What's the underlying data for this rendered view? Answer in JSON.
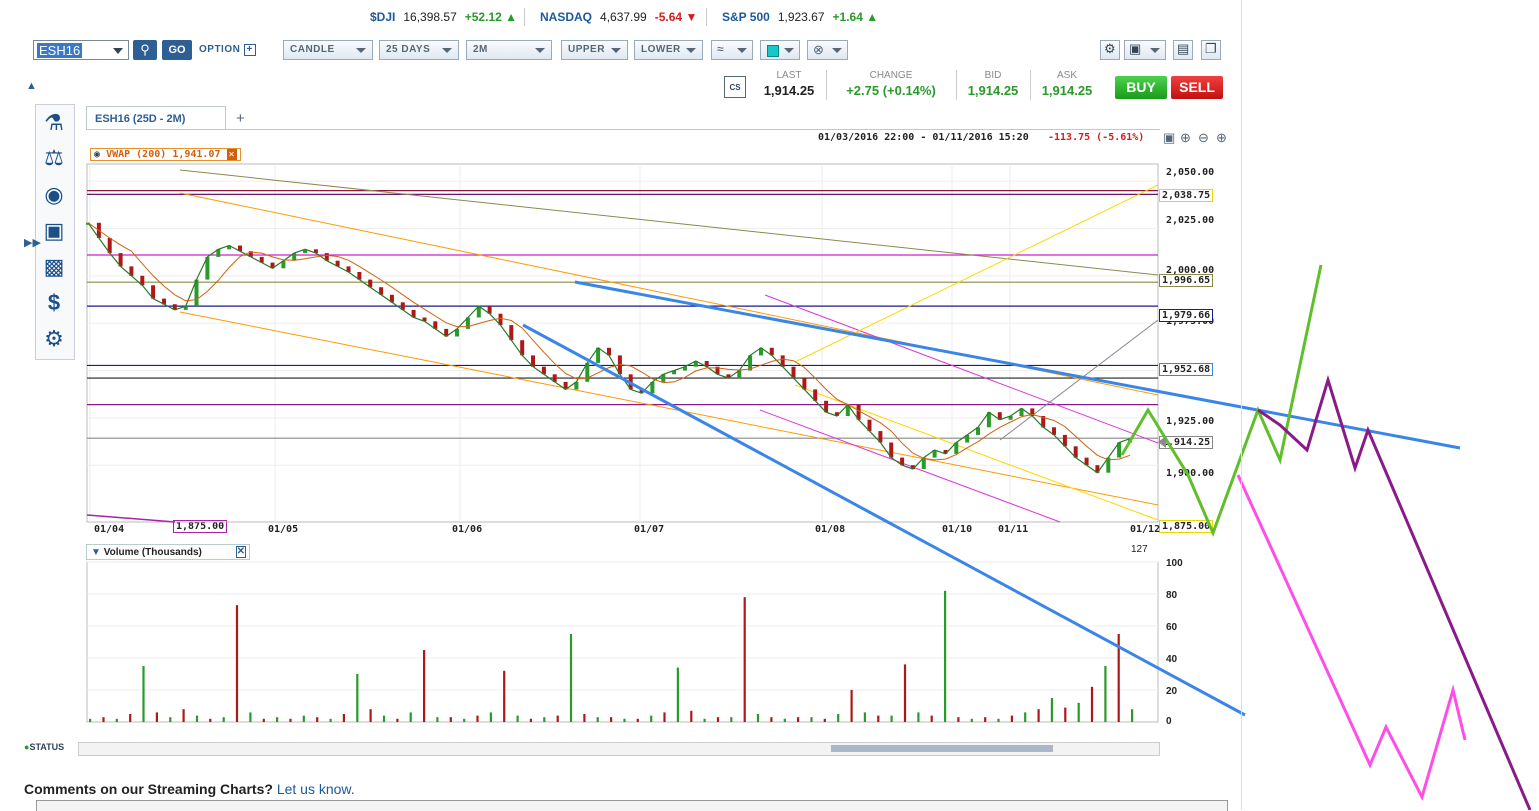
{
  "ticker": [
    {
      "name": "$DJI",
      "value": "16,398.57",
      "change": "+52.12",
      "dir": "up"
    },
    {
      "name": "NASDAQ",
      "value": "4,637.99",
      "change": "-5.64",
      "dir": "down"
    },
    {
      "name": "S&P 500",
      "value": "1,923.67",
      "change": "+1.64",
      "dir": "up"
    }
  ],
  "toolbar": {
    "symbol": "ESH16",
    "go": "GO",
    "option": "OPTION",
    "chart_type": "CANDLE",
    "range": "25 DAYS",
    "interval": "2M",
    "upper": "UPPER",
    "lower": "LOWER"
  },
  "quote": {
    "last_label": "LAST",
    "last": "1,914.25",
    "change_label": "CHANGE",
    "change": "+2.75 (+0.14%)",
    "bid_label": "BID",
    "bid": "1,914.25",
    "ask_label": "ASK",
    "ask": "1,914.25",
    "buy": "BUY",
    "sell": "SELL",
    "cs": "CS"
  },
  "tabs": {
    "active": "ESH16 (25D - 2M)",
    "add": "+"
  },
  "chart_header": {
    "range": "01/03/2016 22:00 - 01/11/2016 15:20",
    "change": "-113.75 (-5.61%)"
  },
  "indicator": {
    "label": "VWAP (200)",
    "value": "1,941.07"
  },
  "volume_panel": {
    "label": "Volume (Thousands)",
    "last": "127"
  },
  "status": "STATUS",
  "footer": {
    "comments": "Comments on our Streaming Charts?",
    "link": "Let us know."
  },
  "colors": {
    "up": "#2a9a2a",
    "down": "#b01818",
    "trend": "#3a86e8",
    "green_path": "#5fbf2a",
    "purple_path": "#8a1a8a",
    "pink_path": "#ff4de8"
  },
  "chart_data": {
    "type": "line",
    "price_axis": {
      "ticks": [
        "2,050.00",
        "2,025.00",
        "2,000.00",
        "1,975.00",
        "1,925.00",
        "1,900.00"
      ],
      "ylim": [
        1870,
        2058
      ]
    },
    "x_ticks": [
      "01/04",
      "01/05",
      "01/06",
      "01/07",
      "01/08",
      "01/10",
      "01/11",
      "01/12"
    ],
    "volume_axis": {
      "ticks": [
        "100",
        "80",
        "60",
        "40",
        "20",
        "0"
      ],
      "ylim": [
        0,
        100
      ]
    },
    "levels": [
      {
        "value": 2038.75,
        "label": "2,038.75",
        "color": "#e8d800"
      },
      {
        "value": 1996.65,
        "label": "1,996.65",
        "color": "#8a8a4a"
      },
      {
        "value": 1979.66,
        "label": "1,979.66",
        "color": "#1a1a8a"
      },
      {
        "value": 1952.68,
        "label": "1,952.68",
        "color": "#3a86e8"
      },
      {
        "value": 1914.25,
        "label": "1,914.25",
        "color": "#888888"
      },
      {
        "value": 1875.0,
        "label": "1,875.00",
        "color": "#e8d800"
      },
      {
        "value": 1875.0,
        "label": "1,875.00",
        "color": "#aa22aa"
      }
    ],
    "price": [
      2028,
      2020,
      2012,
      2005,
      2000,
      1995,
      1988,
      1985,
      1982,
      1984,
      1998,
      2010,
      2014,
      2016,
      2013,
      2010,
      2007,
      2004,
      2008,
      2012,
      2014,
      2012,
      2008,
      2005,
      2002,
      1998,
      1994,
      1990,
      1986,
      1982,
      1978,
      1976,
      1972,
      1968,
      1972,
      1978,
      1984,
      1980,
      1974,
      1966,
      1958,
      1952,
      1948,
      1944,
      1940,
      1944,
      1954,
      1962,
      1958,
      1948,
      1940,
      1938,
      1944,
      1948,
      1950,
      1952,
      1955,
      1952,
      1948,
      1946,
      1950,
      1958,
      1962,
      1958,
      1952,
      1946,
      1940,
      1934,
      1928,
      1926,
      1932,
      1924,
      1918,
      1912,
      1904,
      1900,
      1898,
      1904,
      1908,
      1906,
      1912,
      1916,
      1920,
      1928,
      1924,
      1926,
      1930,
      1926,
      1920,
      1916,
      1910,
      1904,
      1900,
      1896,
      1904,
      1912,
      1914
    ],
    "volume": [
      2,
      3,
      2,
      5,
      35,
      6,
      3,
      8,
      4,
      2,
      3,
      73,
      6,
      2,
      3,
      2,
      4,
      3,
      2,
      5,
      30,
      8,
      4,
      2,
      6,
      45,
      3,
      3,
      2,
      4,
      6,
      32,
      4,
      2,
      3,
      4,
      55,
      5,
      3,
      3,
      2,
      2,
      4,
      6,
      34,
      7,
      2,
      3,
      3,
      78,
      5,
      3,
      2,
      3,
      3,
      2,
      5,
      20,
      6,
      4,
      4,
      36,
      6,
      4,
      82,
      3,
      2,
      3,
      2,
      4,
      6,
      8,
      15,
      9,
      12,
      22,
      35,
      55,
      8
    ]
  }
}
